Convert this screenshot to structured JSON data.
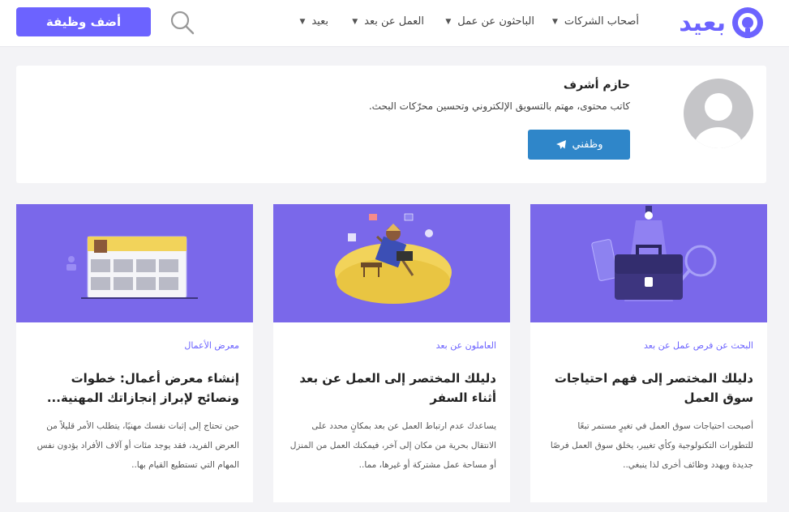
{
  "header": {
    "logo_text": "بعيد",
    "nav": [
      {
        "label": "أصحاب الشركات"
      },
      {
        "label": "الباحثون عن عمل"
      },
      {
        "label": "العمل عن بعد"
      },
      {
        "label": "بعيد"
      }
    ],
    "add_job_label": "أضف وظيفة",
    "accent_color": "#6c63ff"
  },
  "author": {
    "name": "حازم أشرف",
    "bio": "كاتب محتوى، مهتم بالتسويق الإلكتروني وتحسين محرّكات البحث.",
    "hire_label": "وظفني",
    "button_color": "#2f86c9"
  },
  "cards": [
    {
      "category": "البحث عن فرص عمل عن بعد",
      "title": "دليلك المختصر إلى فهم احتياجات سوق العمل",
      "excerpt": "أصبحت احتياجات سوق العمل في تغيرٍ مستمر تبعًا للتطورات التكنولوجية وكأي تغيير، يخلق سوق العمل فرصًا جديدة ويهدد وظائف أخرى لذا ينبغي.."
    },
    {
      "category": "العاملون عن بعد",
      "title": "دليلك المختصر إلى العمل عن بعد أثناء السفر",
      "excerpt": "يساعدك عدم ارتباط العمل عن بعد بمكانٍ محدد على الانتقال بحرية من مكان إلى آخر، فيمكنك العمل من المنزل أو مساحة عمل مشتركة أو غيرها، مما.."
    },
    {
      "category": "معرض الأعمال",
      "title": "إنشاء معرض أعمال: خطوات ونصائح لإبراز إنجازاتك المهنية...",
      "excerpt": "حين تحتاج إلى إثبات نفسك مهنيًا، يتطلب الأمر قليلاً من العرض الفريد، فقد يوجد مئات أو آلاف الأفراد يؤدون نفس المهام التي تستطيع القيام بها.."
    }
  ],
  "card_image_color": "#7a68ea"
}
